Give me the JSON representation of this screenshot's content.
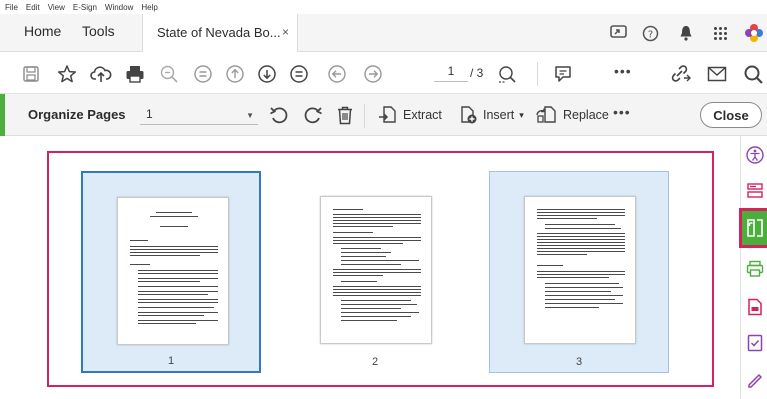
{
  "menubar": {
    "items": [
      "File",
      "Edit",
      "View",
      "E-Sign",
      "Window",
      "Help"
    ]
  },
  "tabs": {
    "home": "Home",
    "tools": "Tools",
    "document": "State of Nevada Bo...",
    "close_glyph": "×"
  },
  "toolbar": {
    "page_current": "1",
    "page_total": "/ 3",
    "more": "•••"
  },
  "organize": {
    "title": "Organize Pages",
    "page_select_value": "1",
    "extract_label": "Extract",
    "insert_label": "Insert",
    "insert_caret": "▾",
    "replace_label": "Replace",
    "more": "•••",
    "close_label": "Close",
    "accent_color": "#4caf3d"
  },
  "pages": [
    {
      "label": "1",
      "state": "selected"
    },
    {
      "label": "2",
      "state": "normal"
    },
    {
      "label": "3",
      "state": "hover"
    }
  ],
  "colors": {
    "highlight": "#d4235a",
    "selection_border": "#2f78c4",
    "selection_fill": "#dcebf7"
  }
}
